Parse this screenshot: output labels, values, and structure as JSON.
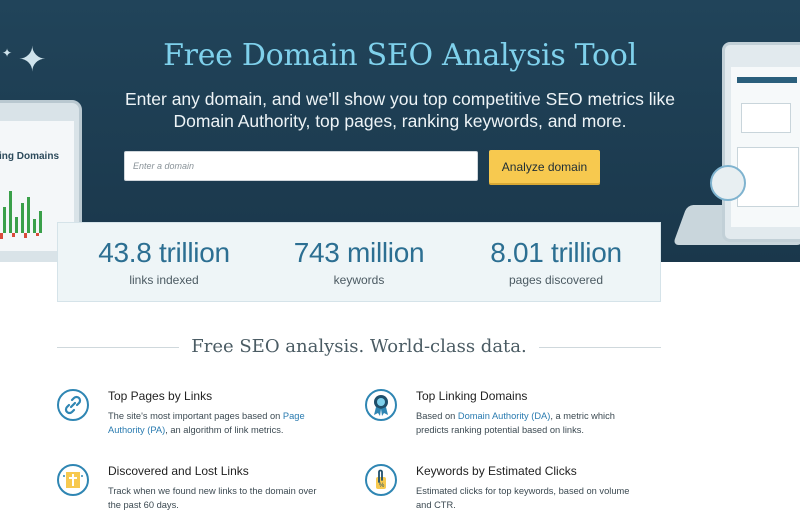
{
  "hero": {
    "title": "Free Domain SEO Analysis Tool",
    "subtitle": "Enter any domain, and we'll show you top competitive SEO metrics like Domain Authority, top pages, ranking keywords, and more.",
    "input_placeholder": "Enter a domain",
    "analyze_button": "Analyze domain",
    "illustration_left_label": "ing Domains"
  },
  "stats": [
    {
      "value": "43.8 trillion",
      "label": "links indexed"
    },
    {
      "value": "743 million",
      "label": "keywords"
    },
    {
      "value": "8.01 trillion",
      "label": "pages discovered"
    }
  ],
  "section_heading": "Free SEO analysis. World-class data.",
  "features": [
    {
      "title": "Top Pages by Links",
      "desc_before": "The site's most important pages based on ",
      "desc_link": "Page Authority (PA)",
      "desc_after": ", an algorithm of link metrics.",
      "icon": "link-icon"
    },
    {
      "title": "Top Linking Domains",
      "desc_before": "Based on ",
      "desc_link": "Domain Authority (DA)",
      "desc_after": ", a metric which predicts ranking potential based on links.",
      "icon": "award-ribbon-icon"
    },
    {
      "title": "Discovered and Lost Links",
      "desc_before": "Track when we found new links to the domain over the past 60 days.",
      "desc_link": "",
      "desc_after": "",
      "icon": "calendar-links-icon"
    },
    {
      "title": "Keywords by Estimated Clicks",
      "desc_before": "Estimated clicks for top keywords, based on volume and CTR.",
      "desc_link": "",
      "desc_after": "",
      "icon": "cursor-click-icon"
    }
  ],
  "colors": {
    "hero_bg": "#1c3a4e",
    "title": "#7fd1ec",
    "button": "#f7c94f",
    "stat_value": "#2c6f92",
    "link": "#2a7bb0"
  }
}
